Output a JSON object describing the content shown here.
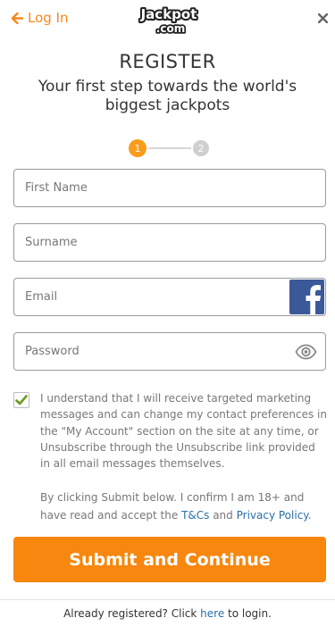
{
  "header": {
    "back_label": "Log In",
    "logo_line1": "Jackpot",
    "logo_line2": ".com",
    "close_icon": "close-icon",
    "accent_color": "#f7871d"
  },
  "title": "REGISTER",
  "subtitle": "Your first step towards the world's biggest jackpots",
  "steps": {
    "current": "1",
    "next": "2"
  },
  "form": {
    "first_name_placeholder": "First Name",
    "surname_placeholder": "Surname",
    "email_placeholder": "Email",
    "password_placeholder": "Password",
    "email_social_icon": "facebook-icon",
    "password_toggle_icon": "eye-icon"
  },
  "consent": {
    "checked": true,
    "text": "I understand that I will receive targeted marketing messages and can change my contact preferences in the \"My Account\" section on the site at any time, or Unsubscribe through the Unsubscribe link provided in all email messages themselves."
  },
  "legal": {
    "prefix": "By clicking Submit below. I confirm I am 18+ and have read and accept the ",
    "terms_link": "T&Cs",
    "joiner": " and ",
    "privacy_link": "Privacy Policy",
    "suffix": "."
  },
  "submit_label": "Submit and Continue",
  "footer": {
    "prefix": "Already registered? Click ",
    "link": "here",
    "suffix": " to login."
  }
}
